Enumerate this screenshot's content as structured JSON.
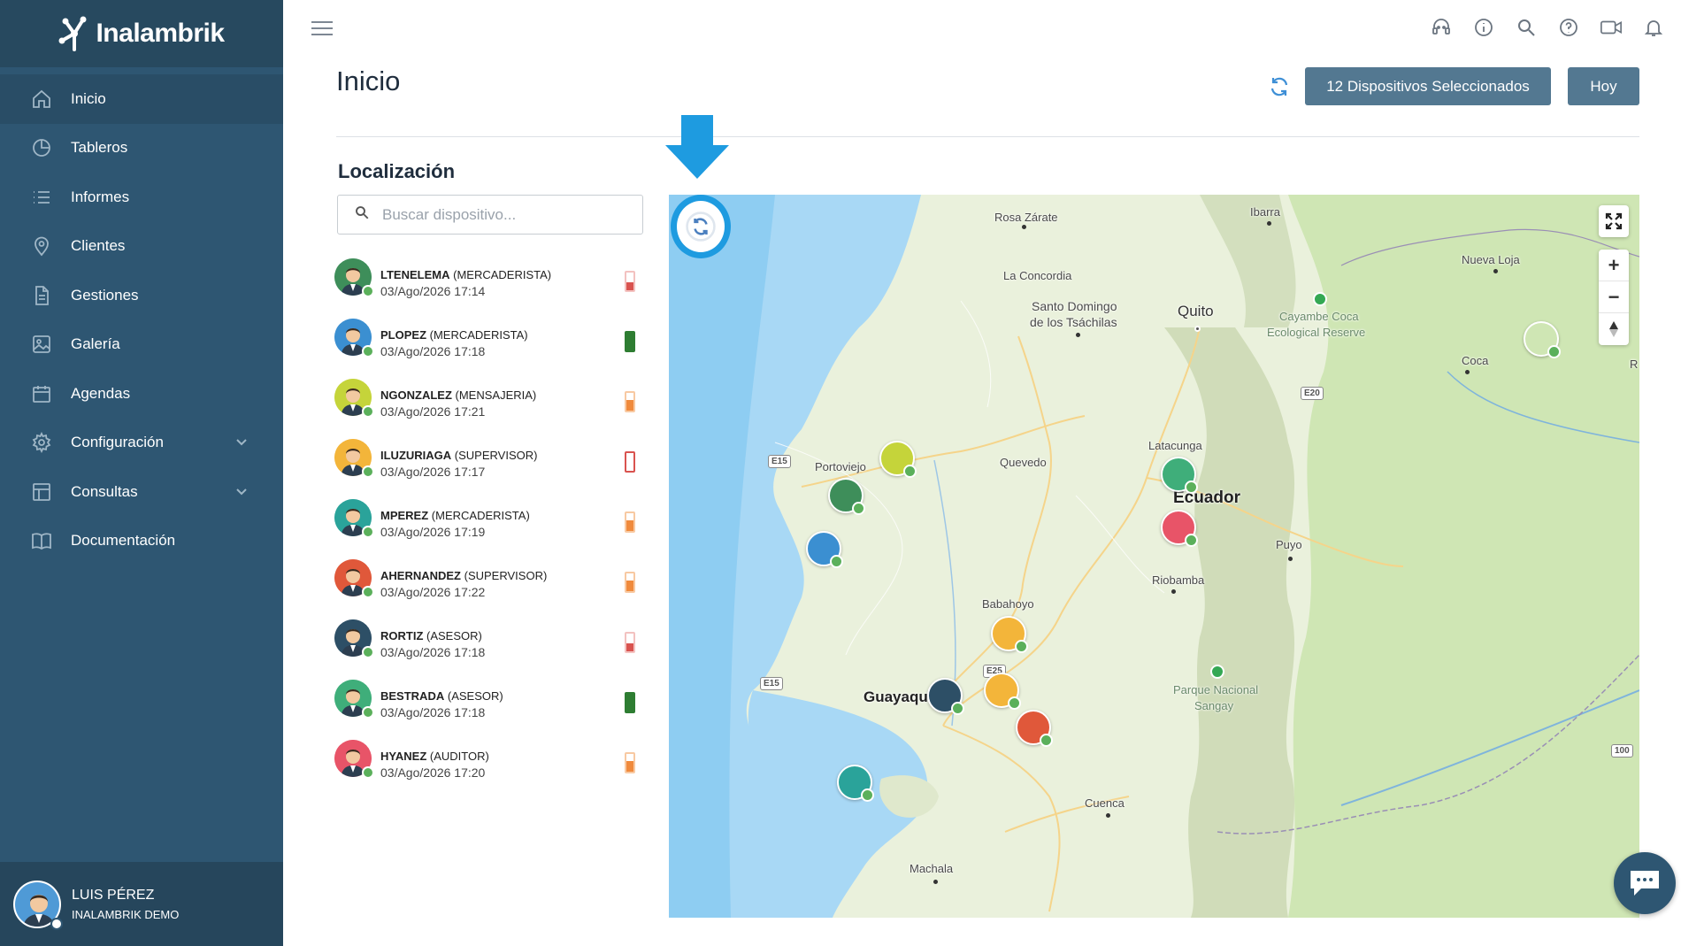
{
  "app": {
    "logo_text": "Inalambrik"
  },
  "sidebar": {
    "items": [
      {
        "label": "Inicio",
        "icon": "home-icon"
      },
      {
        "label": "Tableros",
        "icon": "pie-chart-icon"
      },
      {
        "label": "Informes",
        "icon": "list-icon"
      },
      {
        "label": "Clientes",
        "icon": "location-pin-icon"
      },
      {
        "label": "Gestiones",
        "icon": "document-icon"
      },
      {
        "label": "Galería",
        "icon": "image-icon"
      },
      {
        "label": "Agendas",
        "icon": "calendar-icon"
      },
      {
        "label": "Configuración",
        "icon": "gear-icon"
      },
      {
        "label": "Consultas",
        "icon": "table-icon"
      },
      {
        "label": "Documentación",
        "icon": "book-icon"
      }
    ],
    "user": {
      "name": "LUIS PÉREZ",
      "org": "INALAMBRIK DEMO"
    }
  },
  "header": {
    "title": "Inicio",
    "devices_button": "12 Dispositivos Seleccionados",
    "today_button": "Hoy"
  },
  "location": {
    "title": "Localización",
    "search_placeholder": "Buscar dispositivo..."
  },
  "devices": [
    {
      "user": "LTENELEMA",
      "role": "(MERCADERISTA)",
      "time": "03/Ago/2026 17:14",
      "battery": "low",
      "color": "#3e8e5a"
    },
    {
      "user": "PLOPEZ",
      "role": "(MERCADERISTA)",
      "time": "03/Ago/2026 17:18",
      "battery": "full",
      "color": "#3b8fd1"
    },
    {
      "user": "NGONZALEZ",
      "role": "(MENSAJERIA)",
      "time": "03/Ago/2026 17:21",
      "battery": "medium",
      "color": "#c5d43a"
    },
    {
      "user": "ILUZURIAGA",
      "role": "(SUPERVISOR)",
      "time": "03/Ago/2026 17:17",
      "battery": "empty",
      "color": "#f3b53a"
    },
    {
      "user": "MPEREZ",
      "role": "(MERCADERISTA)",
      "time": "03/Ago/2026 17:19",
      "battery": "medium",
      "color": "#2aa39a"
    },
    {
      "user": "AHERNANDEZ",
      "role": "(SUPERVISOR)",
      "time": "03/Ago/2026 17:22",
      "battery": "medium",
      "color": "#e0583a"
    },
    {
      "user": "RORTIZ",
      "role": "(ASESOR)",
      "time": "03/Ago/2026 17:18",
      "battery": "low",
      "color": "#2d4f66"
    },
    {
      "user": "BESTRADA",
      "role": "(ASESOR)",
      "time": "03/Ago/2026 17:18",
      "battery": "full",
      "color": "#3fae7a"
    },
    {
      "user": "HYANEZ",
      "role": "(AUDITOR)",
      "time": "03/Ago/2026 17:20",
      "battery": "medium",
      "color": "#e85468"
    }
  ],
  "map": {
    "places": [
      "Rosa Zárate",
      "Ibarra",
      "La Concordia",
      "Santo Domingo",
      "de los Tsáchilas",
      "Quito",
      "Cayambe Coca",
      "Ecological Reserve",
      "Nueva Loja",
      "Coca",
      "Portoviejo",
      "Quevedo",
      "Latacunga",
      "Ecuador",
      "Puyo",
      "Riobamba",
      "Babahoyo",
      "Guayaquil",
      "Parque Nacional",
      "Sangay",
      "Cuenca",
      "Machala",
      "R"
    ],
    "roads": [
      "E15",
      "E20",
      "E15",
      "E25",
      "100"
    ]
  },
  "colors": {
    "sidebar_bg": "#2e5672",
    "button_bg": "#537891",
    "accent_blue": "#1e9be0",
    "online_green": "#5bb05b"
  }
}
